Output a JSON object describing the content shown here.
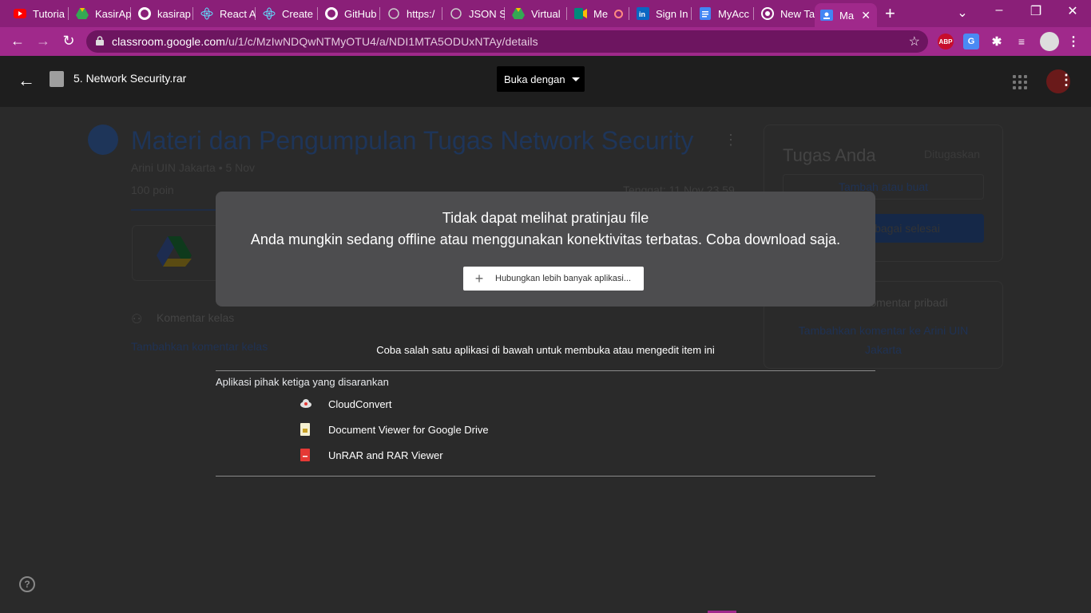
{
  "browser": {
    "tabs": [
      {
        "label": "Tutoria",
        "icon": "youtube-icon",
        "color": "#ff0000"
      },
      {
        "label": "KasirAp",
        "icon": "google-drive-icon",
        "color": "#34a853"
      },
      {
        "label": "kasirap",
        "icon": "github-icon",
        "color": "#ffffff"
      },
      {
        "label": "React A",
        "icon": "react-icon",
        "color": "#61dafb"
      },
      {
        "label": "Create",
        "icon": "react-icon",
        "color": "#61dafb"
      },
      {
        "label": "GitHub",
        "icon": "github-icon",
        "color": "#ffffff"
      },
      {
        "label": "https:/",
        "icon": "web-icon",
        "color": "#cccccc"
      },
      {
        "label": "JSON S",
        "icon": "web-icon",
        "color": "#cccccc"
      },
      {
        "label": "Virtual",
        "icon": "google-drive-icon",
        "color": "#fbbc04"
      },
      {
        "label": "Me",
        "icon": "meet-icon",
        "color": "#00897b"
      },
      {
        "label": "Sign In",
        "icon": "linkedin-icon",
        "color": "#0a66c2"
      },
      {
        "label": "MyAcc",
        "icon": "docs-icon",
        "color": "#4285f4"
      },
      {
        "label": "New Ta",
        "icon": "chrome-icon",
        "color": "#ffffff"
      },
      {
        "label": "Ma",
        "icon": "classroom-icon",
        "color": "#4285f4"
      }
    ],
    "url_host": "classroom.google.com",
    "url_path": "/u/1/c/MzIwNDQwNTMyOTU4/a/NDI1MTA5ODUxNTAy/details",
    "accent_color": "#a0298b",
    "extensions": [
      {
        "label": "ABP",
        "color": "#c70d2c"
      },
      {
        "label": "G",
        "color": "#4a8af4"
      }
    ]
  },
  "viewer": {
    "file_name": "5. Network Security.rar",
    "open_with_label": "Buka dengan"
  },
  "background_page": {
    "title": "Materi dan Pengumpulan Tugas Network Security",
    "meta": "Arini UIN Jakarta • 5 Nov",
    "points": "100 poin",
    "due": "Tenggat: 11 Nov 23.59",
    "comments_label": "Komentar kelas",
    "add_comment": "Tambahkan komentar kelas",
    "your_work_title": "Tugas Anda",
    "your_work_status": "Ditugaskan",
    "add_or_create": "Tambah atau buat",
    "mark_done": "Tandai sebagai selesai",
    "private_comments": "Komentar pribadi",
    "add_private_comment": "Tambahkan komentar ke Arini UIN Jakarta"
  },
  "preview_error": {
    "title": "Tidak dapat melihat pratinjau file",
    "message": "Anda mungkin sedang offline atau menggunakan konektivitas terbatas. Coba download saja.",
    "connect_button": "Hubungkan lebih banyak aplikasi..."
  },
  "suggestions": {
    "try_text": "Coba salah satu aplikasi di bawah untuk membuka atau mengedit item ini",
    "section_label": "Aplikasi pihak ketiga yang disarankan",
    "apps": [
      {
        "name": "CloudConvert",
        "icon": "cloudconvert-icon",
        "color": "#e0e0e0"
      },
      {
        "name": "Document Viewer for Google Drive",
        "icon": "document-viewer-icon",
        "color": "#f5f0d0"
      },
      {
        "name": "UnRAR and RAR Viewer",
        "icon": "unrar-icon",
        "color": "#e53935"
      }
    ]
  }
}
